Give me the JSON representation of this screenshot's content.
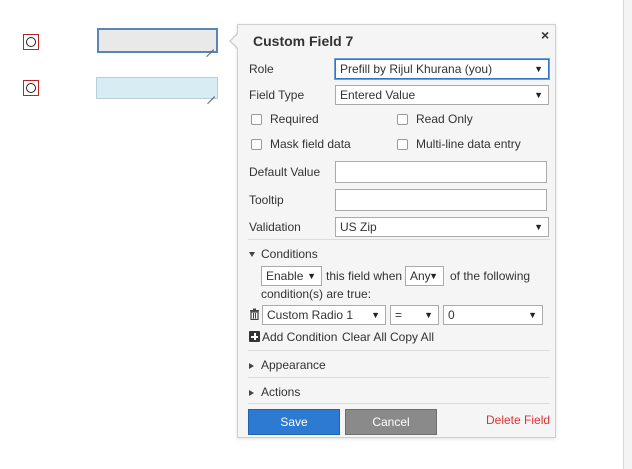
{
  "panel": {
    "title": "Custom Field 7",
    "close": "×",
    "role_label": "Role",
    "role_value": "Prefill by Rijul Khurana (you)",
    "field_type_label": "Field Type",
    "field_type_value": "Entered Value",
    "required_label": "Required",
    "read_only_label": "Read Only",
    "mask_label": "Mask field data",
    "multiline_label": "Multi-line data entry",
    "default_value_label": "Default Value",
    "default_value": "",
    "tooltip_label": "Tooltip",
    "tooltip_value": "",
    "validation_label": "Validation",
    "validation_value": "US Zip",
    "conditions": {
      "header": "Conditions",
      "action_value": "Enable",
      "text_1": "this field when",
      "match_value": "Any",
      "text_2": "of the following",
      "text_3": "condition(s) are true:",
      "row": {
        "field": "Custom Radio 1",
        "operator": "=",
        "value": "0"
      },
      "add_condition": "Add Condition",
      "clear_all": "Clear All",
      "copy_all": "Copy All"
    },
    "appearance": "Appearance",
    "actions": "Actions",
    "save": "Save",
    "cancel": "Cancel",
    "delete": "Delete Field"
  },
  "colors": {
    "primary": "#2d7ad3",
    "danger": "#e03030",
    "radio_border": "#bb2222",
    "field_fill": "#d8edf3"
  },
  "icons": [
    "radio-icon",
    "resize-grip-icon",
    "close-icon",
    "caret-down-icon",
    "trash-icon",
    "plus-icon",
    "triangle-right-icon",
    "triangle-down-icon"
  ]
}
